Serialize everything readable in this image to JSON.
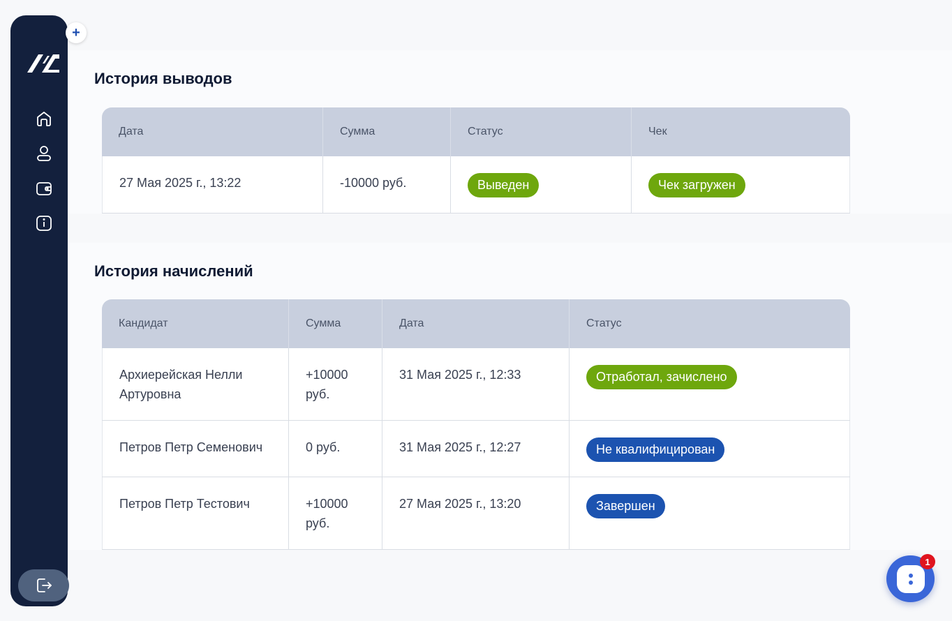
{
  "sidebar": {
    "expand_label": "+",
    "nav": [
      {
        "name": "home",
        "icon": "home-icon"
      },
      {
        "name": "profile",
        "icon": "user-icon"
      },
      {
        "name": "wallet",
        "icon": "wallet-icon"
      },
      {
        "name": "info",
        "icon": "info-icon"
      }
    ],
    "logout_icon": "logout-icon"
  },
  "withdrawals": {
    "title": "История выводов",
    "columns": [
      "Дата",
      "Сумма",
      "Статус",
      "Чек"
    ],
    "rows": [
      {
        "date": "27 Мая 2025 г., 13:22",
        "amount": "-10000 руб.",
        "status": "Выведен",
        "receipt": "Чек загружен"
      }
    ]
  },
  "accruals": {
    "title": "История начислений",
    "columns": [
      "Кандидат",
      "Сумма",
      "Дата",
      "Статус"
    ],
    "rows": [
      {
        "candidate": "Архиерейская Нелли Артуровна",
        "amount": "+10000 руб.",
        "date": "31 Мая 2025 г., 12:33",
        "status": "Отработал, зачислено",
        "status_color": "green"
      },
      {
        "candidate": "Петров Петр Семенович",
        "amount": "0 руб.",
        "date": "31 Мая 2025 г., 12:27",
        "status": "Не квалифицирован",
        "status_color": "blue"
      },
      {
        "candidate": "Петров Петр Тестович",
        "amount": "+10000 руб.",
        "date": "27 Мая 2025 г., 13:20",
        "status": "Завершен",
        "status_color": "blue"
      }
    ]
  },
  "chat": {
    "unread_count": "1",
    "icon": "chat-icon"
  },
  "colors": {
    "sidebar": "#13203d",
    "header_row": "#c8cfde",
    "status_green": "#6ea70d",
    "status_blue": "#1c53b0",
    "chat": "#3a66d8",
    "notification": "#e0141e"
  }
}
